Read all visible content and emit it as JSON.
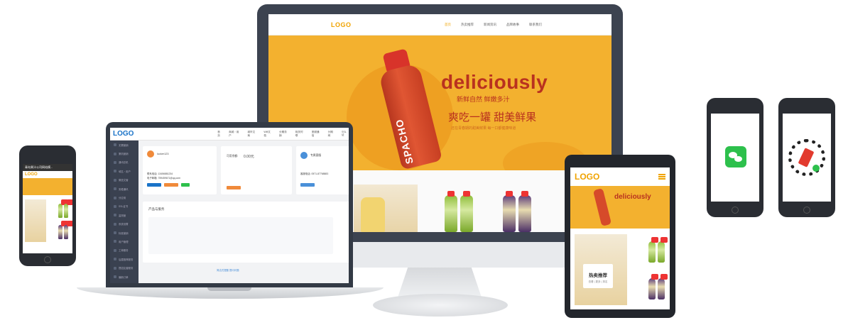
{
  "desktop": {
    "logo": "LOGO",
    "menu": [
      "首页",
      "热卖推荐",
      "新闻资讯",
      "品牌故事",
      "联系我们"
    ],
    "hero_title": "deliciously",
    "hero_sub1": "新鲜自然  鲜嫩多汁",
    "hero_sub2": "爽吃一罐  甜美鲜果",
    "hero_sub3": "还在青春期的甜美鲜果 每一口都健康味道",
    "bottle_label": "SPACHO"
  },
  "laptop": {
    "logo": "LOGO",
    "menu": [
      "首页",
      "商城・用户",
      "城市文商",
      "Wifi文档",
      "分期务销",
      "相关时联",
      "宽频通信",
      "分期网",
      "SSL证"
    ],
    "sidebar": [
      "无需营销",
      "第机营销",
      "通讯总机",
      "域名・用户",
      "微信文管",
      "安稳通讯",
      "分应用",
      "SSL证书",
      "监测营",
      "系统设置",
      "标准营销",
      "用户管理",
      "工单服务",
      "后盾推荐服务",
      "提招友营服务",
      "偏新订单"
    ],
    "card1_user": "lucker123",
    "card1_phone": "联系电话: 13456881234",
    "card1_email": "电子邮箱: 759459671@qq.com",
    "card2_title": "可用余额:",
    "card2_value": "0.00元",
    "card3_title": "专属客服",
    "card3_phone": "客服电话: 0571-87768883",
    "section_title": "产品与服务",
    "footer": "简洁式提醒  提问问题"
  },
  "tablet": {
    "logo": "LOGO",
    "hero_title": "deliciously",
    "card_title": "热卖推荐",
    "card_sub": "查看 | 更多 | 排名"
  },
  "phone_left": {
    "title": "青岛果汁公司网站模...",
    "logo": "LOGO"
  },
  "colors": {
    "brand_orange": "#f3b12f",
    "brand_red": "#b9311f",
    "laptop_blue": "#1a73c8",
    "wechat_green": "#2dc04c"
  }
}
